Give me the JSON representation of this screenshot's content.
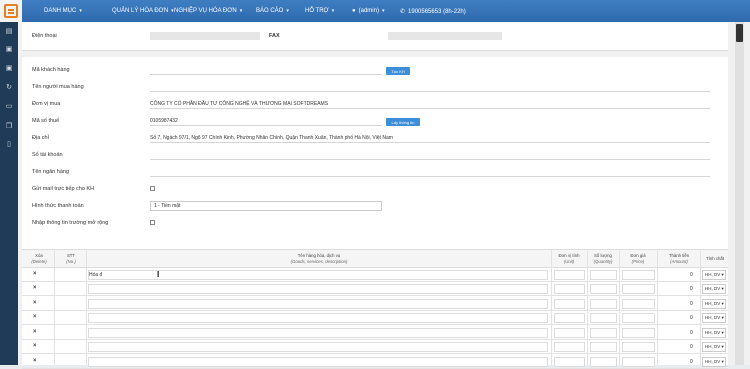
{
  "nav": {
    "items": [
      {
        "label": "DANH MỤC"
      },
      {
        "label": "QUẢN LÝ HÓA ĐƠN"
      },
      {
        "label": "NGHIỆP VỤ HÓA ĐƠN"
      },
      {
        "label": "BÁO CÁO"
      },
      {
        "label": "HỖ TRỢ"
      }
    ],
    "user": "(admin)",
    "hotline": "1900565653 (8h-22h)"
  },
  "top": {
    "phone_label": "Điện thoại",
    "fax_label": "FAX"
  },
  "form": {
    "ma_khach_hang": {
      "label": "Mã khách hàng",
      "button": "Tạo KH"
    },
    "ten_nguoi_mua": {
      "label": "Tên người mua hàng"
    },
    "don_vi_mua": {
      "label": "Đơn vị mua",
      "value": "CÔNG TY CỔ PHẦN ĐẦU TƯ CÔNG NGHỆ VÀ THƯƠNG MẠI SOFTDREAMS"
    },
    "ma_so_thue": {
      "label": "Mã số thuế",
      "value": "0105987432",
      "button": "Lấy thông tin"
    },
    "dia_chi": {
      "label": "Địa chỉ",
      "value": "Số 7, Ngách 97/1, Ngõ 97 Chính Kinh, Phường Nhân Chính, Quận Thanh Xuân, Thành phố Hà Nội, Việt Nam"
    },
    "so_tai_khoan": {
      "label": "Số tài khoản"
    },
    "ten_ngan_hang": {
      "label": "Tên ngân hàng"
    },
    "gui_mail": {
      "label": "Gửi mail trực tiếp cho KH",
      "checked": false
    },
    "hinh_thuc": {
      "label": "Hình thức thanh toán",
      "value": "1 - Tiền mặt"
    },
    "nhap_mo_rong": {
      "label": "Nhập thông tin trường mở rộng",
      "checked": false
    }
  },
  "table": {
    "headers": {
      "xoa": "Xóa",
      "xoa_en": "(Delete)",
      "stt": "STT",
      "stt_en": "(No.)",
      "ten": "Tên hàng hóa, dịch vụ",
      "ten_en": "(Goods, services, description)",
      "dvt": "Đơn vị tính",
      "dvt_en": "(Unit)",
      "sl": "Số lượng",
      "sl_en": "(Quantity)",
      "dg": "Đơn giá",
      "dg_en": "(Price)",
      "tt": "Thành tiền",
      "tt_en": "(Amount)",
      "tc": "Tính chất"
    },
    "first_row_input": "Hóa đ",
    "row_x": "×",
    "row_amount": "0",
    "row_tinh_chat": "HH, DV"
  }
}
